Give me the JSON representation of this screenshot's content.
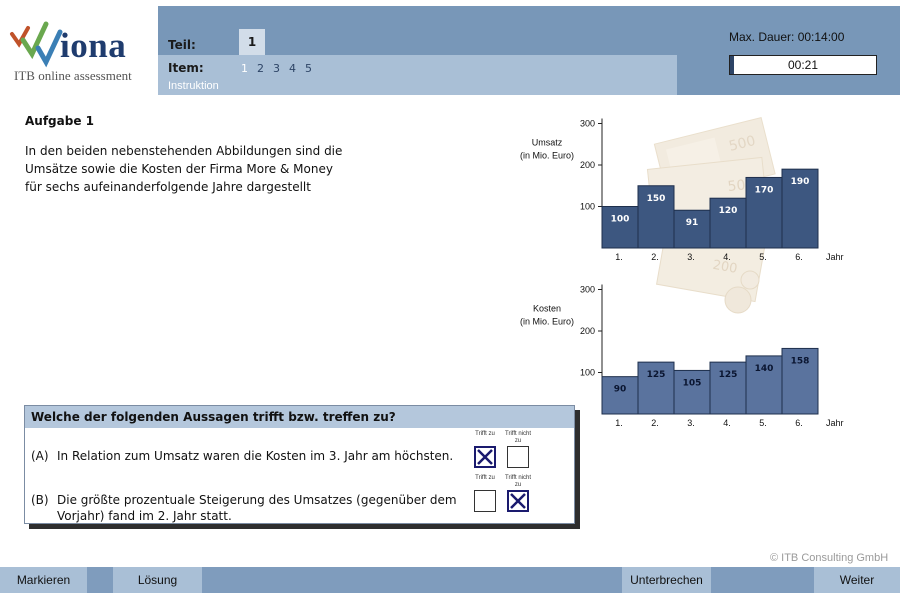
{
  "logo": {
    "text": "iona",
    "subtitle": "ITB online assessment"
  },
  "header": {
    "teil_label": "Teil:",
    "teil_value": "1",
    "item_label": "Item:",
    "items": [
      "1",
      "2",
      "3",
      "4",
      "5"
    ],
    "active_item": "1",
    "instruktion_label": "Instruktion",
    "dauer_text": "Max. Dauer: 00:14:00",
    "timer_value": "00:21",
    "timer_progress": 0.025
  },
  "task": {
    "title": "Aufgabe 1",
    "text": "In den beiden nebenstehenden Abbildungen sind die Umsätze sowie die Kosten der Firma More & Money für sechs aufeinanderfolgende Jahre dargestellt"
  },
  "question": {
    "header": "Welche der folgenden Aussagen trifft bzw. treffen zu?",
    "option_true_label": "Trifft zu",
    "option_false_label": "Trifft nicht zu",
    "statements": [
      {
        "prefix": "(A)",
        "text": "In Relation zum Umsatz waren die Kosten im 3. Jahr am höchsten.",
        "answer": "trifft_zu"
      },
      {
        "prefix": "(B)",
        "text": "Die größte prozentuale Steigerung des Umsatzes (gegenüber dem Vorjahr) fand im 2. Jahr statt.",
        "answer": "trifft_nicht_zu"
      }
    ]
  },
  "chart_data": [
    {
      "type": "bar",
      "ylabel": "Umsatz (in Mio. Euro)",
      "xlabel": "Jahr",
      "categories": [
        "1.",
        "2.",
        "3.",
        "4.",
        "5.",
        "6."
      ],
      "values": [
        100,
        150,
        91,
        120,
        170,
        190
      ],
      "yticks": [
        100,
        200,
        300
      ],
      "ylim": [
        0,
        300
      ],
      "bar_color": "#3d5780",
      "label_color": "#ffffff"
    },
    {
      "type": "bar",
      "ylabel": "Kosten (in Mio. Euro)",
      "xlabel": "Jahr",
      "categories": [
        "1.",
        "2.",
        "3.",
        "4.",
        "5.",
        "6."
      ],
      "values": [
        90,
        125,
        105,
        125,
        140,
        158
      ],
      "yticks": [
        100,
        200,
        300
      ],
      "ylim": [
        0,
        300
      ],
      "bar_color": "#5a739e",
      "label_color": "#0a1530"
    }
  ],
  "copyright": "© ITB Consulting GmbH",
  "footer": {
    "markieren": "Markieren",
    "loesung": "Lösung",
    "unterbrechen": "Unterbrechen",
    "weiter": "Weiter"
  },
  "colors": {
    "header": "#7897b8",
    "band": "#a9bfd6",
    "accent": "#2d4466"
  }
}
